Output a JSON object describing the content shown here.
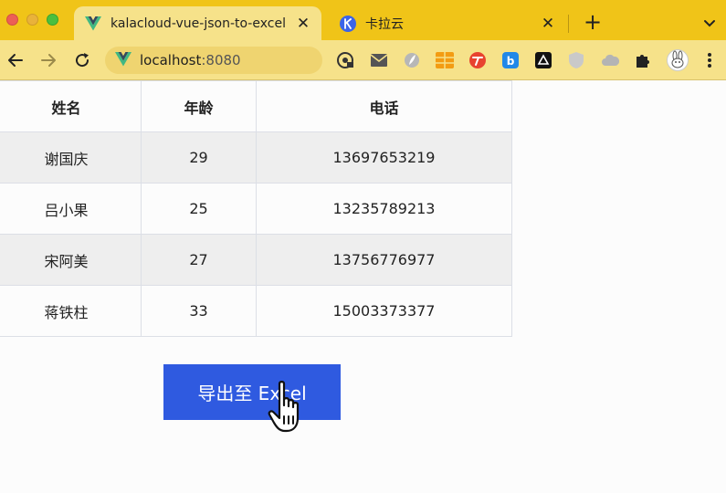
{
  "browser": {
    "tabs": [
      {
        "title": "kalacloud-vue-json-to-excel",
        "favicon": "vue-icon",
        "active": true
      },
      {
        "title": "卡拉云",
        "favicon": "kalacloud-icon",
        "active": false
      }
    ],
    "url_host": "localhost",
    "url_port": ":8080",
    "colors": {
      "tabstrip": "#f0c418",
      "toolbar": "#f6e28a",
      "omnibox": "#efd470"
    }
  },
  "extensions": [
    "password-manager-icon",
    "mail-icon",
    "feather-icon",
    "grid-icon",
    "t-icon",
    "b-icon",
    "triangle-app-icon",
    "shield-icon",
    "cloud-icon",
    "puzzle-icon",
    "rabbit-avatar-icon"
  ],
  "table": {
    "headers": [
      "姓名",
      "年龄",
      "电话"
    ],
    "rows": [
      [
        "谢国庆",
        "29",
        "13697653219"
      ],
      [
        "吕小果",
        "25",
        "13235789213"
      ],
      [
        "宋阿美",
        "27",
        "13756776977"
      ],
      [
        "蒋铁柱",
        "33",
        "15003373377"
      ]
    ]
  },
  "export_button": {
    "label": "导出至 Excel",
    "color": "#2f5ae0"
  }
}
